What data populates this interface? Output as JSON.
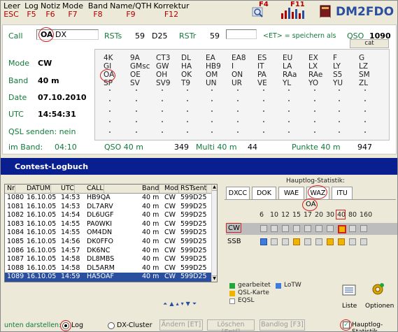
{
  "menu": [
    {
      "label": "Leer",
      "key": "ESC"
    },
    {
      "label": "Log",
      "key": "F5"
    },
    {
      "label": "Notiz",
      "key": "F6"
    },
    {
      "label": "Mode",
      "key": "F7"
    },
    {
      "label": "Band",
      "key": "F8"
    },
    {
      "label": "Name/QTH",
      "key": "F9"
    },
    {
      "label": "Korrektur",
      "key": "F12"
    }
  ],
  "toolbar": {
    "search_key": "F4",
    "stats_key": "F11",
    "title": "DM2FDO"
  },
  "entry": {
    "call_label": "Call",
    "call_value": "OA",
    "call_suffix": "DX",
    "rsts_label": "RSTs",
    "rsts_value": "59",
    "rsts_extra": "D25",
    "rstr_label": "RSTr",
    "rstr_value": "59",
    "hint": "<ET> = speichern als",
    "qso_label": "QSO",
    "qso_value": "1090",
    "cat_label": "cat",
    "mode_label": "Mode",
    "mode_value": "CW",
    "band_label": "Band",
    "band_value": "40 m",
    "date_label": "Date",
    "date_value": "07.10.2010",
    "utc_label": "UTC",
    "utc_value": "14:54:31",
    "qsl_label": "QSL senden: nein"
  },
  "prefix_grid": [
    [
      "4K",
      "9A",
      "CT3",
      "DL",
      "EA",
      "EA8",
      "ES",
      "EU",
      "EX",
      "F",
      "G"
    ],
    [
      "GI",
      "GMsc",
      "GW",
      "HA",
      "HB9",
      "I",
      "IT",
      "LA",
      "LX",
      "LY",
      "LZ"
    ],
    [
      "OA",
      "OE",
      "OH",
      "OK",
      "OM",
      "ON",
      "PA",
      "RAa",
      "RAe",
      "S5",
      "SM"
    ],
    [
      "SP",
      "SV",
      "SV9",
      "T9",
      "UN",
      "UR",
      "VE",
      "YL",
      "YO",
      "YU",
      "ZL"
    ]
  ],
  "status": {
    "imband_label": "im Band:",
    "imband_value": "04:10",
    "qso_band_label": "QSO 40 m",
    "qso_band_value": "349",
    "multi_label": "Multi 40 m",
    "multi_value": "44",
    "punkte_label": "Punkte 40 m",
    "punkte_value": "947"
  },
  "logbook": {
    "title": "Contest-Logbuch",
    "columns": [
      "Nr",
      "DATUM",
      "UTC",
      "CALL",
      "Band",
      "Mod",
      "RSTsent"
    ],
    "rows": [
      [
        "1080",
        "16.10.05",
        "14:53",
        "HB9QA",
        "40 m",
        "CW",
        "599D25"
      ],
      [
        "1081",
        "16.10.05",
        "14:53",
        "DL7ARV",
        "40 m",
        "CW",
        "599D25"
      ],
      [
        "1082",
        "16.10.05",
        "14:54",
        "DL6UGF",
        "40 m",
        "CW",
        "599D25"
      ],
      [
        "1083",
        "16.10.05",
        "14:55",
        "PA0WKI",
        "40 m",
        "CW",
        "599D25"
      ],
      [
        "1084",
        "16.10.05",
        "14:55",
        "OM4DN",
        "40 m",
        "CW",
        "599D25"
      ],
      [
        "1085",
        "16.10.05",
        "14:56",
        "DK0FFO",
        "40 m",
        "CW",
        "599D25"
      ],
      [
        "1086",
        "16.10.05",
        "14:57",
        "DK6NC",
        "40 m",
        "CW",
        "599D25"
      ],
      [
        "1087",
        "16.10.05",
        "14:58",
        "DL8MBS",
        "40 m",
        "CW",
        "599D25"
      ],
      [
        "1088",
        "16.10.05",
        "14:58",
        "DL5ARM",
        "40 m",
        "CW",
        "599D25"
      ],
      [
        "1089",
        "16.10.05",
        "14:59",
        "HA5OAF",
        "40 m",
        "CW",
        "599D25"
      ]
    ],
    "selected_index": 9
  },
  "stats": {
    "title": "Hauptlog-Statistik:",
    "tabs": [
      "DXCC",
      "DOK",
      "WAE",
      "WAZ",
      "ITU"
    ],
    "active_tab": "DXCC",
    "prefix": "OA",
    "bands": [
      "6",
      "10",
      "12",
      "15",
      "17",
      "20",
      "30",
      "40",
      "80",
      "160"
    ],
    "cw_label": "CW",
    "ssb_label": "SSB",
    "cw_states": [
      "none",
      "none",
      "none",
      "none",
      "none",
      "none",
      "none",
      "yellow-selected",
      "none",
      "none"
    ],
    "ssb_states": [
      "blue",
      "none",
      "none",
      "yellow",
      "none",
      "none",
      "yellow",
      "yellow",
      "none",
      "none"
    ],
    "legend": [
      {
        "label": "gearbeitet",
        "color": "#1fa83a"
      },
      {
        "label": "LoTW",
        "color": "#3d7be0"
      },
      {
        "label": "QSL-Karte",
        "color": "#f0b400"
      },
      {
        "label": "EQSL",
        "color": "#ffffff"
      }
    ],
    "liste_label": "Liste",
    "optionen_label": "Optionen"
  },
  "bottom": {
    "show_label": "unten darstellen:",
    "radio_log": "Log",
    "radio_cluster": "DX-Cluster",
    "btn_andern": "Ändern [ET]",
    "btn_loschen": "Löschen [Entf]",
    "btn_bandlog": "Bandlog [F3]",
    "checkbox_label": "Hauptlog-Statistik"
  }
}
